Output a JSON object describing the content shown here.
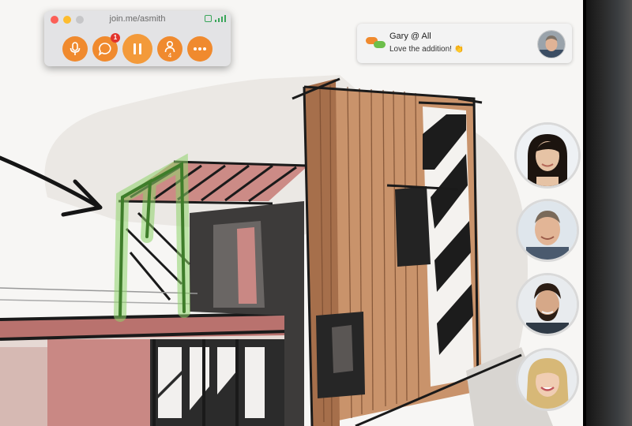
{
  "control_window": {
    "url": "join.me/asmith",
    "chat_badge": "1",
    "participant_count": "4",
    "buttons": [
      "microphone",
      "chat",
      "pause",
      "participants",
      "more"
    ]
  },
  "chat_toast": {
    "sender": "Gary @ All",
    "message": "Love the addition! 👏"
  },
  "participants": [
    {
      "name": "participant-1",
      "skin": "#e6c3a5",
      "hair": "#1c140f",
      "bg": "#eef1f4"
    },
    {
      "name": "participant-2",
      "skin": "#e2b596",
      "hair": "#7a6a5a",
      "bg": "#dfe6ec"
    },
    {
      "name": "participant-3",
      "skin": "#d6a888",
      "hair": "#2b1d14",
      "bg": "#e8ebee"
    },
    {
      "name": "participant-4",
      "skin": "#f0cdb3",
      "hair": "#d7b877",
      "bg": "#e9ecef"
    }
  ],
  "colors": {
    "accent_orange": "#f08a2e",
    "signal_green": "#3aa65a",
    "badge_red": "#e2332c",
    "sketch_wood": "#c9936b",
    "sketch_red": "#c98884",
    "highlight_green": "#6dbf4b"
  }
}
